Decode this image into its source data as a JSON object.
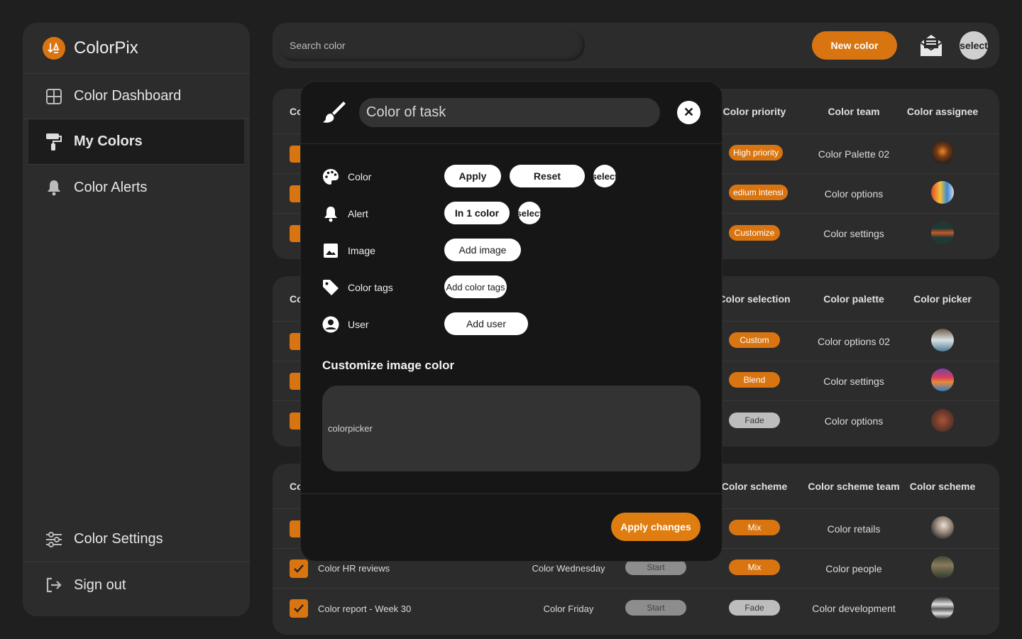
{
  "app": {
    "name": "ColorPix"
  },
  "sidebar": {
    "items": [
      {
        "label": "Color Dashboard",
        "icon": "grid-icon"
      },
      {
        "label": "My Colors",
        "icon": "paint-roller-icon",
        "active": true
      },
      {
        "label": "Color Alerts",
        "icon": "bell-icon"
      }
    ],
    "settings_label": "Color Settings",
    "signout_label": "Sign out"
  },
  "topbar": {
    "search_placeholder": "Search color",
    "new_color_label": "New color",
    "avatar_label": "select"
  },
  "cards": [
    {
      "head_first": "Co",
      "headers": [
        "Color priority",
        "Color team",
        "Color assignee"
      ],
      "rows": [
        {
          "pill": "High priority",
          "team": "Color Palette 02"
        },
        {
          "pill": "edium intensi",
          "team": "Color options"
        },
        {
          "pill": "Customize",
          "team": "Color settings"
        }
      ]
    },
    {
      "head_first": "Co",
      "headers": [
        "Color selection",
        "Color palette",
        "Color picker"
      ],
      "rows": [
        {
          "pill": "Custom",
          "team": "Color options 02"
        },
        {
          "pill": "Blend",
          "team": "Color settings"
        },
        {
          "pill": "Fade",
          "team": "Color options"
        }
      ]
    },
    {
      "head_first": "Co",
      "headers": [
        "Color scheme",
        "Color scheme team",
        "Color scheme"
      ],
      "rows": [
        {
          "name": "",
          "day": "",
          "status": "",
          "pill": "Mix",
          "team": "Color retails"
        },
        {
          "name": "Color HR reviews",
          "day": "Color Wednesday",
          "status": "Start",
          "pill": "Mix",
          "team": "Color people"
        },
        {
          "name": "Color report - Week 30",
          "day": "Color Friday",
          "status": "Start",
          "pill": "Fade",
          "team": "Color development"
        }
      ]
    }
  ],
  "modal": {
    "title_value": "Color of task",
    "properties": [
      {
        "label": "Color",
        "icon": "palette-icon"
      },
      {
        "label": "Alert",
        "icon": "bell-icon"
      },
      {
        "label": "Image",
        "icon": "image-icon"
      },
      {
        "label": "Color tags",
        "icon": "tag-icon"
      },
      {
        "label": "User",
        "icon": "user-icon"
      }
    ],
    "color_apply": "Apply",
    "color_reset": "Reset",
    "color_select": "select",
    "alert_value": "In 1 color",
    "alert_select": "select",
    "add_image": "Add image",
    "add_tags": "Add color tags",
    "add_user": "Add user",
    "section_title": "Customize image color",
    "picker_label": "colorpicker",
    "apply_changes": "Apply changes"
  },
  "colors": {
    "accent": "#d97511",
    "background": "#1f1f1f",
    "panel": "#2c2c2c",
    "modal": "#161616"
  }
}
